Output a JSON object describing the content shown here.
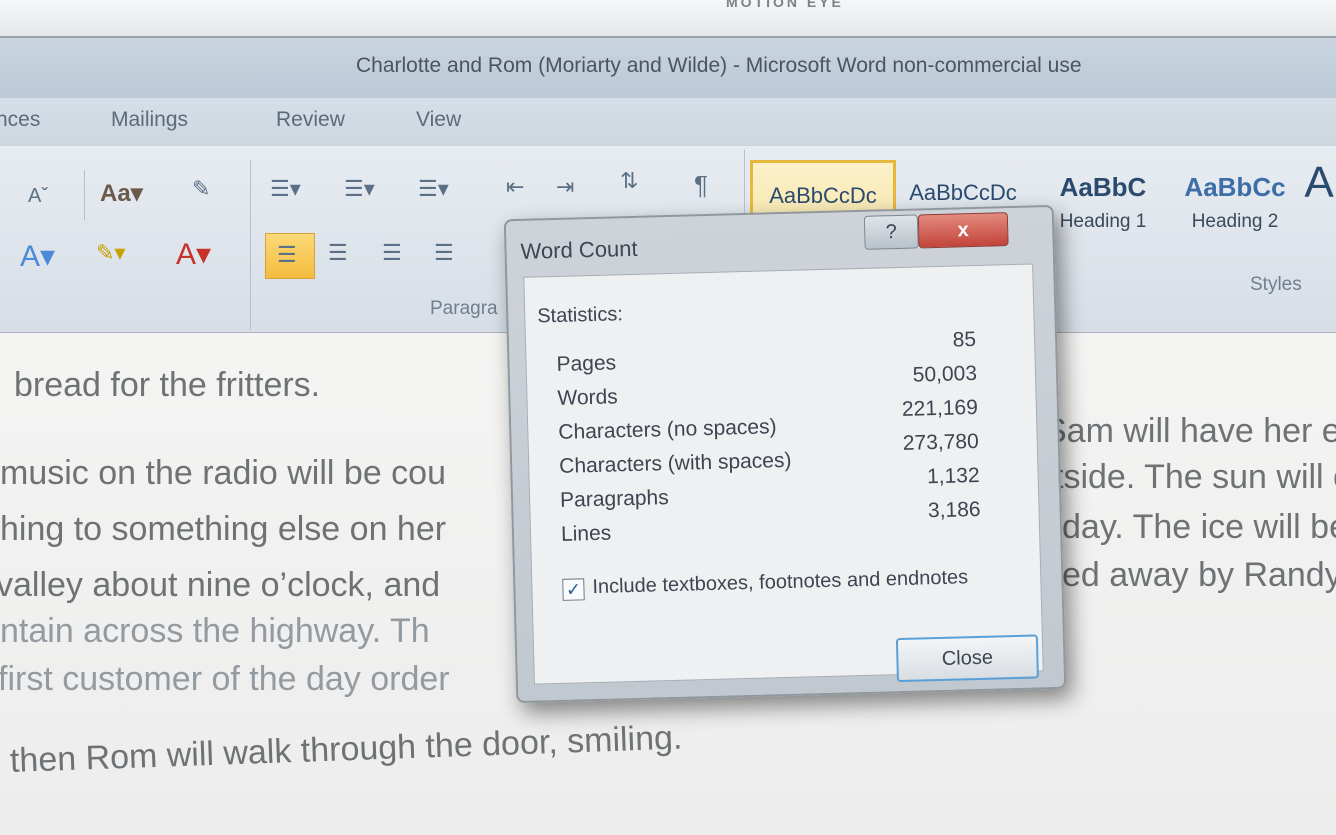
{
  "bezel": {
    "brand": "MOTION EYE"
  },
  "window": {
    "title": "Charlotte and Rom (Moriarty and Wilde)  -  Microsoft Word non-commercial use"
  },
  "tabs": [
    "nces",
    "Mailings",
    "Review",
    "View"
  ],
  "ribbon": {
    "groups": {
      "paragraph": "Paragra",
      "styles": "Styles"
    },
    "font_size_label": "Aa",
    "styles": [
      {
        "sample": "AaBbCcDc",
        "name": ""
      },
      {
        "sample": "AaBbCcDc",
        "name": ""
      },
      {
        "sample": "AaBbC",
        "name": "Heading 1"
      },
      {
        "sample": "AaBbCc",
        "name": "Heading 2"
      },
      {
        "sample": "A",
        "name": ""
      }
    ]
  },
  "document": {
    "lines": [
      "bread for the fritters.",
      "music on the radio will be cou",
      "hing to something else on her",
      "valley about nine o’clock, and",
      "ntain across the highway.   Th",
      "first customer of the day order",
      "then Rom will walk through the door, smiling."
    ],
    "right_lines": [
      "Sam will have her ear",
      "tside.  The sun will c",
      "day.  The ice will be",
      "ed away by Randy’s"
    ]
  },
  "dialog": {
    "title": "Word Count",
    "help": "?",
    "close_x": "x",
    "statistics_label": "Statistics:",
    "stats": [
      {
        "name": "Pages",
        "value": "85"
      },
      {
        "name": "Words",
        "value": "50,003"
      },
      {
        "name": "Characters (no spaces)",
        "value": "221,169"
      },
      {
        "name": "Characters (with spaces)",
        "value": "273,780"
      },
      {
        "name": "Paragraphs",
        "value": "1,132"
      },
      {
        "name": "Lines",
        "value": "3,186"
      }
    ],
    "include_label": "Include textboxes, footnotes and endnotes",
    "include_checked": true,
    "check_glyph": "✓",
    "close_button": "Close"
  },
  "colors": {
    "accent": "#5aa0d8",
    "close_red": "#c2443a",
    "active_style": "#e6b93c"
  }
}
